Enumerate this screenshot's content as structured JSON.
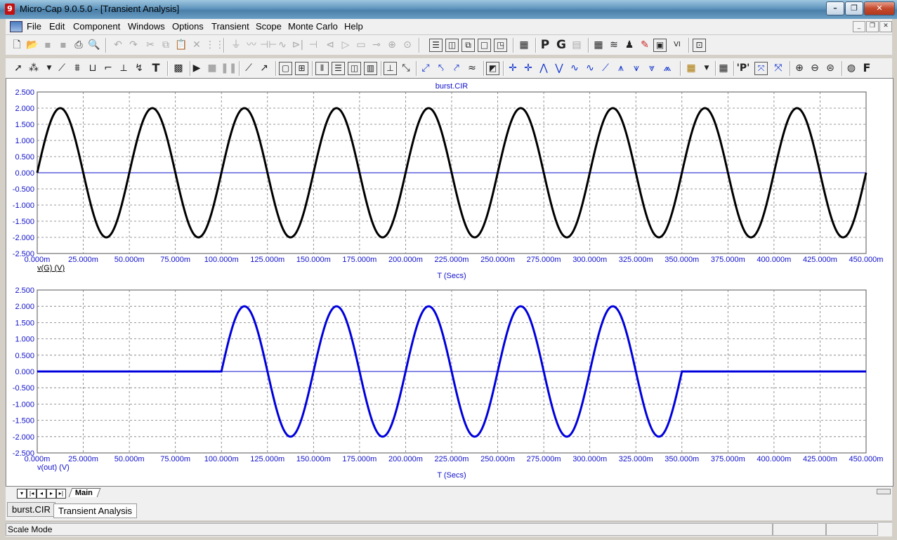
{
  "window": {
    "title": "Micro-Cap 9.0.5.0 - [Transient Analysis]",
    "app_icon": "micro-cap-logo-icon"
  },
  "menu": [
    "File",
    "Edit",
    "Component",
    "Windows",
    "Options",
    "Transient",
    "Scope",
    "Monte Carlo",
    "Help"
  ],
  "plot_title": "burst.CIR",
  "chart_data": [
    {
      "type": "line",
      "title": "burst.CIR",
      "ylabel": "v(G) (V)",
      "xlabel": "T (Secs)",
      "xlim": [
        0,
        450
      ],
      "ylim": [
        -2.5,
        2.5
      ],
      "x_unit": "ms",
      "grid": true,
      "color": "#000000",
      "yticks": [
        "2.500",
        "2.000",
        "1.500",
        "1.000",
        "0.500",
        "0.000",
        "-0.500",
        "-1.000",
        "-1.500",
        "-2.000",
        "-2.500"
      ],
      "xticks": [
        "0.000m",
        "25.000m",
        "50.000m",
        "75.000m",
        "100.000m",
        "125.000m",
        "150.000m",
        "175.000m",
        "200.000m",
        "225.000m",
        "250.000m",
        "275.000m",
        "300.000m",
        "325.000m",
        "350.000m",
        "375.000m",
        "400.000m",
        "425.000m",
        "450.000m"
      ],
      "series": [
        {
          "amplitude": 2.0,
          "frequency_hz": 20,
          "start_ms": 0,
          "end_ms": 450
        }
      ]
    },
    {
      "type": "line",
      "ylabel": "v(out) (V)",
      "xlabel": "T (Secs)",
      "xlim": [
        0,
        450
      ],
      "ylim": [
        -2.5,
        2.5
      ],
      "x_unit": "ms",
      "grid": true,
      "color": "#0000dd",
      "yticks": [
        "2.500",
        "2.000",
        "1.500",
        "1.000",
        "0.500",
        "0.000",
        "-0.500",
        "-1.000",
        "-1.500",
        "-2.000",
        "-2.500"
      ],
      "xticks": [
        "0.000m",
        "25.000m",
        "50.000m",
        "75.000m",
        "100.000m",
        "125.000m",
        "150.000m",
        "175.000m",
        "200.000m",
        "225.000m",
        "250.000m",
        "275.000m",
        "300.000m",
        "325.000m",
        "350.000m",
        "375.000m",
        "400.000m",
        "425.000m",
        "450.000m"
      ],
      "series": [
        {
          "amplitude": 2.0,
          "frequency_hz": 20,
          "start_ms": 100,
          "end_ms": 350
        }
      ]
    }
  ],
  "tabs": {
    "main": "Main"
  },
  "doc_tabs": [
    "burst.CIR",
    "Transient Analysis"
  ],
  "status": {
    "mode": "Scale Mode"
  }
}
